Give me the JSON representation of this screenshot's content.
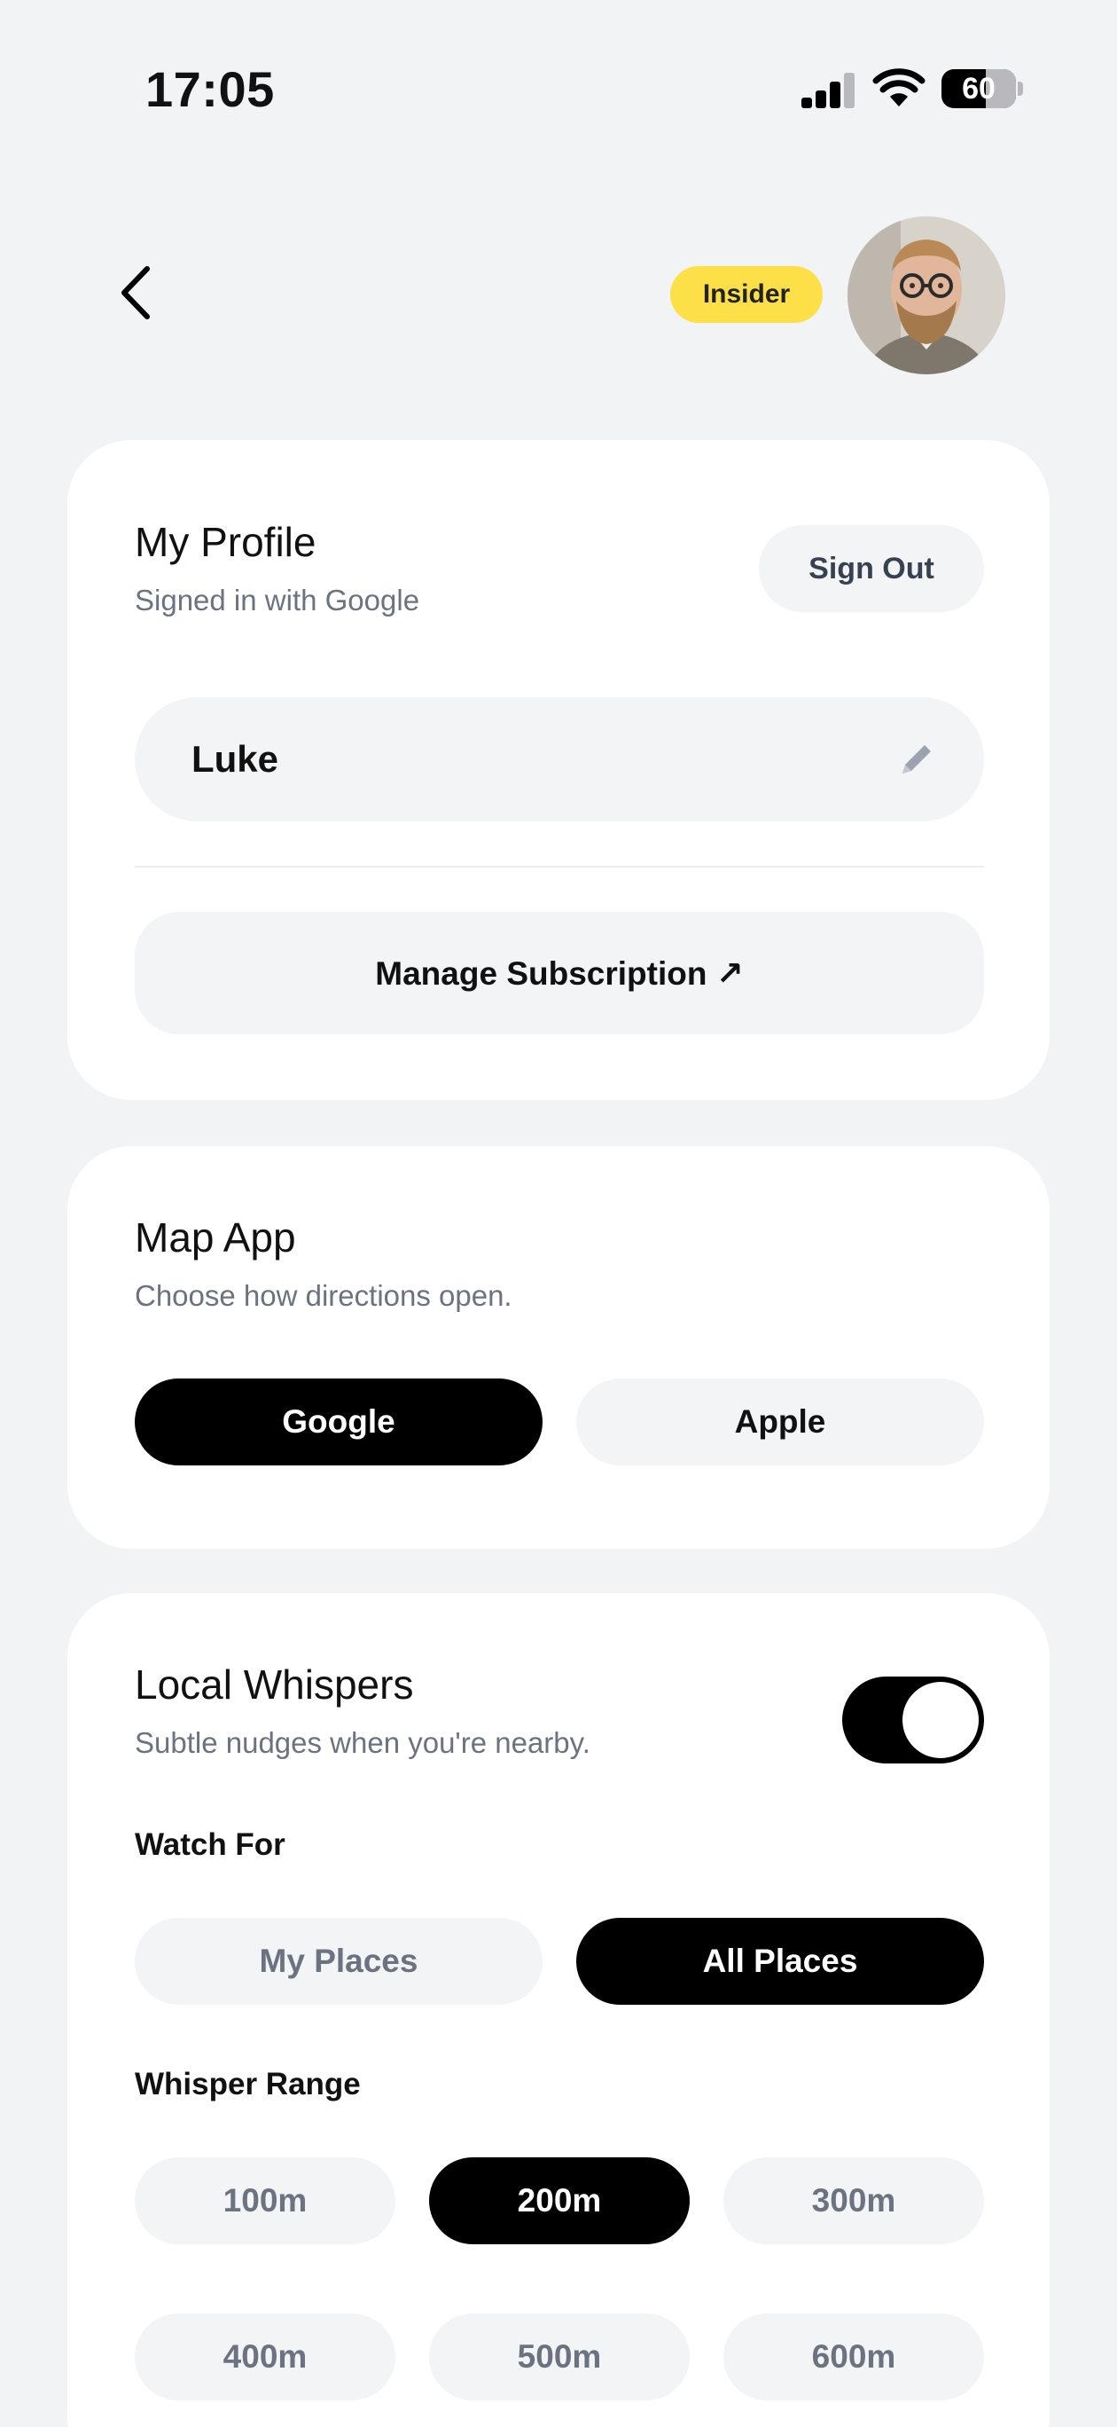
{
  "status_bar": {
    "time": "17:05",
    "battery_level": "60",
    "battery_fraction": 0.6
  },
  "header": {
    "back_icon": "chevron-left-icon",
    "badge": "Insider",
    "badge_color": "#fde047"
  },
  "profile": {
    "title": "My Profile",
    "subtitle": "Signed in with Google",
    "sign_out_label": "Sign Out",
    "name_value": "Luke",
    "edit_icon": "pencil-icon",
    "manage_subscription_label": "Manage Subscription ↗"
  },
  "map_app": {
    "title": "Map App",
    "subtitle": "Choose how directions open.",
    "options": [
      "Google",
      "Apple"
    ],
    "selected": "Google"
  },
  "local_whispers": {
    "title": "Local Whispers",
    "subtitle": "Subtle nudges when you're nearby.",
    "enabled": true,
    "watch_for_label": "Watch For",
    "watch_for_options": [
      "My Places",
      "All Places"
    ],
    "watch_for_selected": "All Places",
    "range_label": "Whisper Range",
    "range_options": [
      "100m",
      "200m",
      "300m",
      "400m",
      "500m",
      "600m"
    ],
    "range_selected": "200m"
  },
  "colors": {
    "background": "#f2f3f5",
    "card": "#ffffff",
    "selected": "#000000",
    "unselected": "#f3f4f6",
    "badge": "#fde047"
  }
}
